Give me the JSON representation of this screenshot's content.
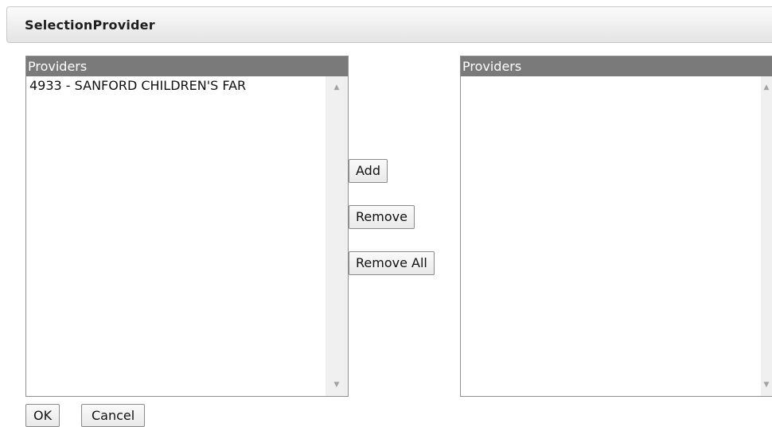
{
  "window": {
    "title": "SelectionProvider"
  },
  "available_list": {
    "header": "Providers",
    "items": [
      "4933 - SANFORD CHILDREN'S FAR"
    ]
  },
  "selected_list": {
    "header": "Providers",
    "items": []
  },
  "actions": {
    "add_label": "Add",
    "remove_label": "Remove",
    "remove_all_label": "Remove All"
  },
  "footer": {
    "ok_label": "OK",
    "cancel_label": "Cancel"
  },
  "icons": {
    "scroll_up": "scroll-up-arrow-icon",
    "scroll_down": "scroll-down-arrow-icon"
  },
  "colors": {
    "list_header_bg": "#7a7a7a",
    "titlebar_gradient_top": "#fbfbfb",
    "titlebar_gradient_bottom": "#e4e4e4"
  }
}
